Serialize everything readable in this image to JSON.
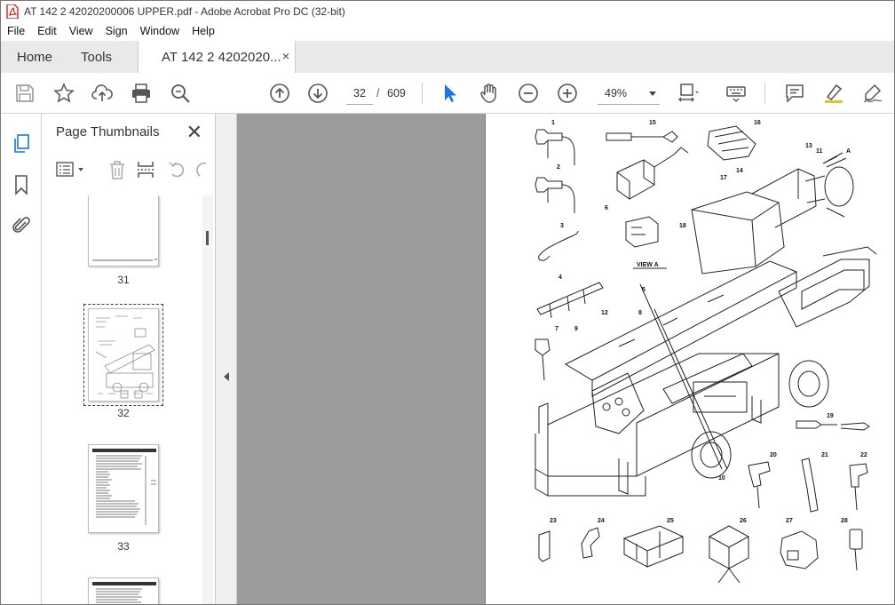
{
  "window": {
    "title": "AT 142 2 42020200006 UPPER.pdf - Adobe Acrobat Pro DC (32-bit)",
    "app_icon": "acrobat-pdf-icon"
  },
  "menu": [
    "File",
    "Edit",
    "View",
    "Sign",
    "Window",
    "Help"
  ],
  "tabs": {
    "home": "Home",
    "tools": "Tools",
    "document": "AT 142 2 4202020...",
    "close": "×"
  },
  "toolbar": {
    "current_page": "32",
    "page_separator": "/",
    "total_pages": "609",
    "zoom": "49%",
    "icons": [
      "save-icon",
      "bookmark-star-icon",
      "upload-share-icon",
      "print-icon",
      "zoom-search-icon",
      "page-up-icon",
      "page-down-icon",
      "select-cursor-icon",
      "hand-tool-icon",
      "zoom-out-icon",
      "zoom-in-icon",
      "fit-page-icon",
      "keyboard-icon",
      "comment-icon",
      "highlight-pen-icon",
      "sign-pen-icon"
    ]
  },
  "left_rail": {
    "icons": [
      "page-thumbnails-icon",
      "bookmarks-icon",
      "attachments-icon"
    ]
  },
  "thumbnails_panel": {
    "title": "Page Thumbnails",
    "close": "✕",
    "pages": [
      {
        "label": "31"
      },
      {
        "label": "32",
        "selected": true
      },
      {
        "label": "33"
      }
    ]
  },
  "document": {
    "view_label": "VIEW A",
    "view_letter": "A",
    "callouts": [
      "1",
      "2",
      "3",
      "4",
      "5",
      "6",
      "7",
      "8",
      "9",
      "10",
      "11",
      "12",
      "13",
      "14",
      "15",
      "16",
      "17",
      "18",
      "19",
      "20",
      "21",
      "22",
      "23",
      "24",
      "25",
      "26",
      "27",
      "28"
    ]
  }
}
